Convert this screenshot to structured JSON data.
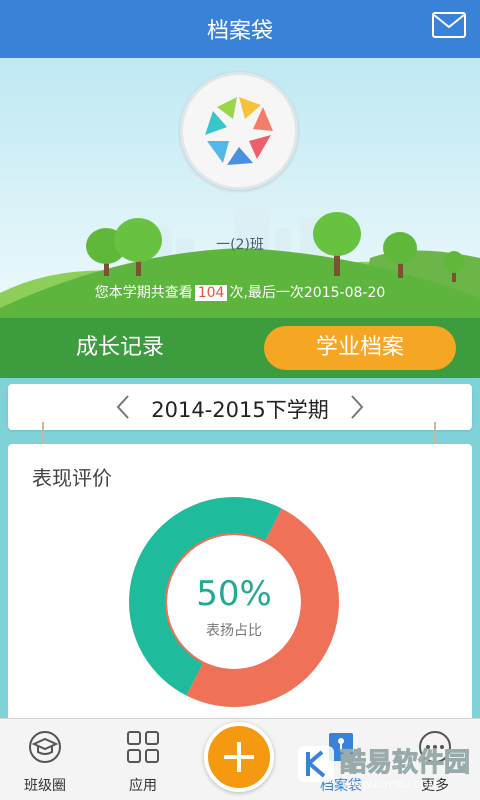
{
  "colors": {
    "header": "#3a82d8",
    "tab_bar": "#3c9c3e",
    "active_tab": "#f5a623",
    "praise": "#1fbb9c",
    "criticism": "#ee7158",
    "fab": "#f59a10"
  },
  "header": {
    "title": "档案袋",
    "mail_icon": "mail-icon"
  },
  "profile": {
    "class_name": "一(2)班",
    "views_prefix": "您本学期共查看",
    "views_count": "104",
    "views_suffix": "次,最后一次2015-08-20"
  },
  "tabs": {
    "growth": "成长记录",
    "academic": "学业档案",
    "active": "academic"
  },
  "semester": {
    "label": "2014-2015下学期"
  },
  "evaluation": {
    "title": "表现评价",
    "percent_text": "50%",
    "percent_label": "表扬占比",
    "praise_fraction": 0.5
  },
  "bottom_nav": {
    "items": [
      {
        "label": "班级圈",
        "icon": "grad-cap-chat-icon"
      },
      {
        "label": "应用",
        "icon": "apps-grid-icon"
      },
      {
        "label": "",
        "icon": "plus-icon"
      },
      {
        "label": "档案袋",
        "icon": "archive-bag-icon"
      },
      {
        "label": "更多",
        "icon": "more-dots-icon"
      }
    ]
  },
  "watermark": {
    "text": "酷易软件园",
    "url": "WWW.KUYIBU.COM"
  }
}
